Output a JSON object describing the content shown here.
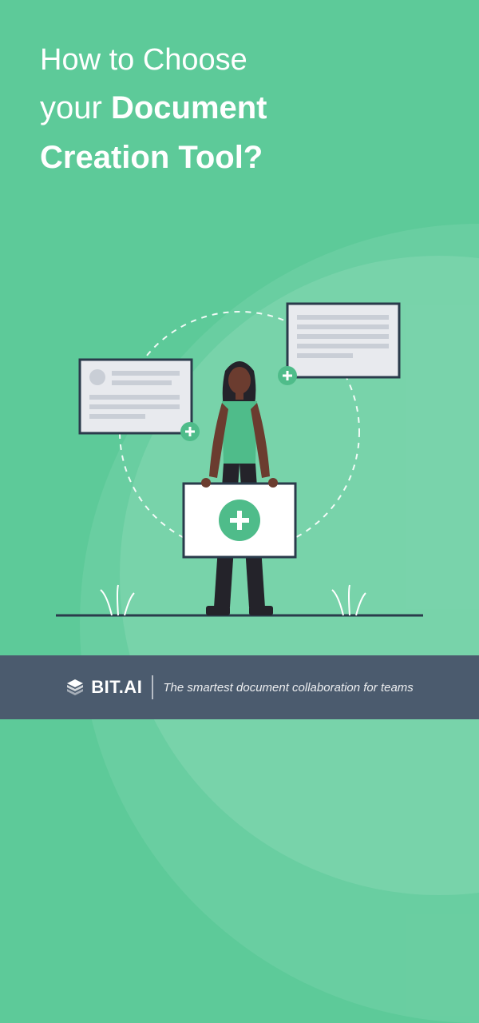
{
  "title": {
    "line1": "How to Choose",
    "line2_light": "your ",
    "line2_bold_a": "Document",
    "line3_bold": "Creation Tool?"
  },
  "footer": {
    "brand": "BIT.AI",
    "tagline": "The smartest document collaboration for teams"
  },
  "colors": {
    "bg": "#5dca99",
    "footer": "#4b5b6e",
    "text": "#ffffff"
  }
}
